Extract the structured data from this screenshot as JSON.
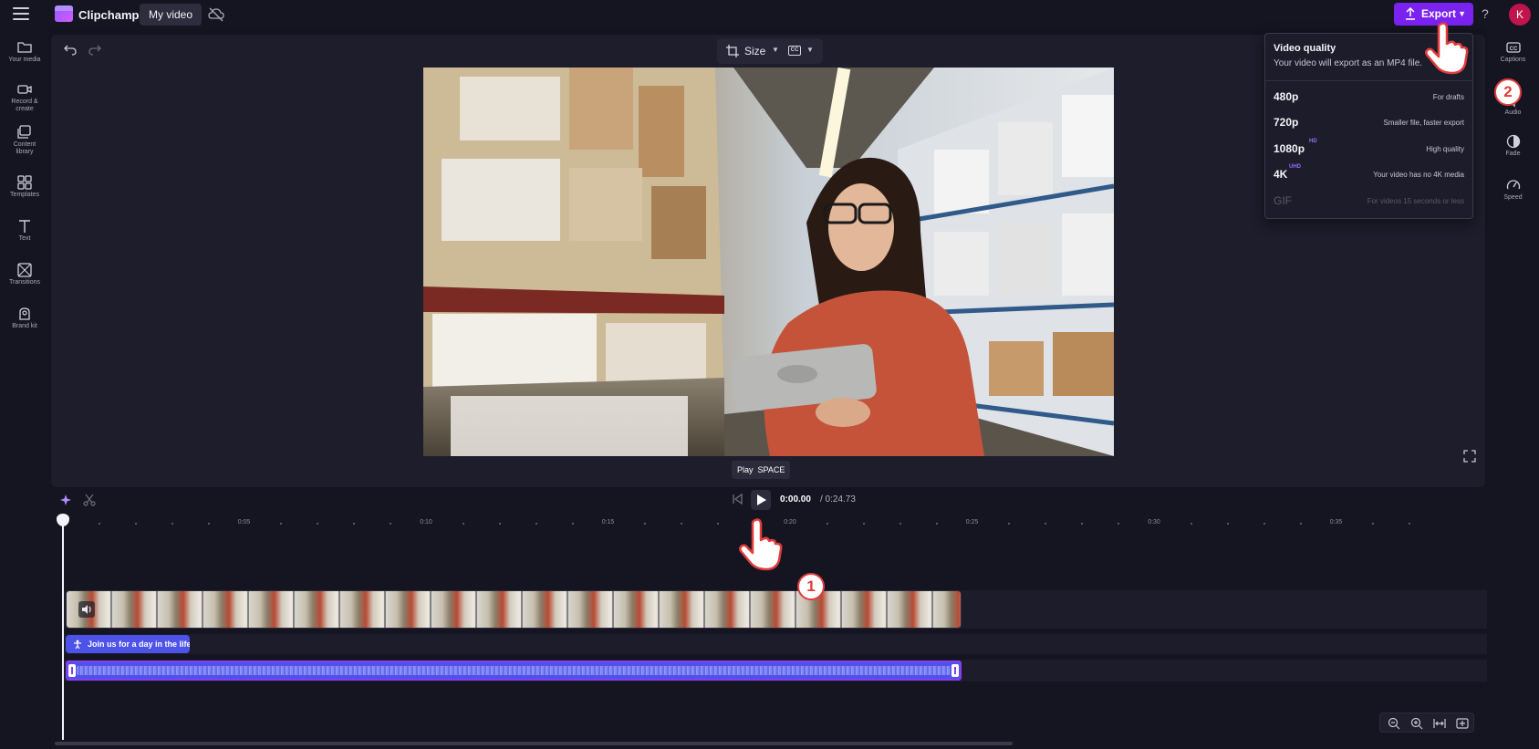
{
  "app": {
    "brand": "Clipchamp",
    "project_title": "My video",
    "export_label": "Export",
    "help_label": "?",
    "avatar_initial": "K",
    "accent_color": "#7a22f0"
  },
  "left_rail": {
    "items": [
      {
        "label": "Your media",
        "icon": "folder-icon"
      },
      {
        "label": "Record & create",
        "icon": "camera-icon"
      },
      {
        "label": "Content library",
        "icon": "library-icon"
      },
      {
        "label": "Templates",
        "icon": "templates-icon"
      },
      {
        "label": "Text",
        "icon": "text-icon"
      },
      {
        "label": "Transitions",
        "icon": "transitions-icon"
      },
      {
        "label": "Brand kit",
        "icon": "brand-kit-icon"
      }
    ]
  },
  "right_rail": {
    "items": [
      {
        "label": "Captions",
        "icon": "captions-icon"
      },
      {
        "label": "Audio",
        "icon": "audio-icon"
      },
      {
        "label": "Fade",
        "icon": "fade-icon"
      },
      {
        "label": "Speed",
        "icon": "speed-icon"
      }
    ]
  },
  "preview": {
    "size_label": "Size"
  },
  "playback": {
    "tooltip_action": "Play",
    "tooltip_key": "SPACE",
    "current_time": "0:00.00",
    "total_time": "/ 0:24.73"
  },
  "ruler": {
    "labels": [
      "0:05",
      "0:10",
      "0:15",
      "0:20",
      "0:25",
      "0:30",
      "0:35"
    ]
  },
  "tracks": {
    "text_clip_label": "Join us for a day in the life"
  },
  "quality_menu": {
    "title": "Video quality",
    "subtitle": "Your video will export as an MP4 file.",
    "options": [
      {
        "name": "480p",
        "badge": "",
        "desc": "For drafts",
        "enabled": true
      },
      {
        "name": "720p",
        "badge": "",
        "desc": "Smaller file, faster export",
        "enabled": true
      },
      {
        "name": "1080p",
        "badge": "HD",
        "desc": "High quality",
        "enabled": true
      },
      {
        "name": "4K",
        "badge": "UHD",
        "desc": "Your video has no 4K media",
        "enabled": true
      },
      {
        "name": "GIF",
        "badge": "",
        "desc": "For videos 15 seconds or less",
        "enabled": false
      }
    ]
  },
  "annotations": {
    "step1": "1",
    "step2": "2"
  }
}
